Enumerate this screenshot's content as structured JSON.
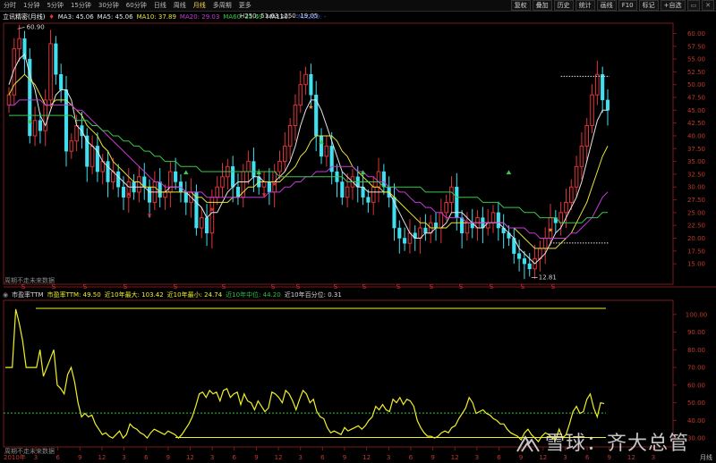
{
  "toolbar": {
    "tabs": [
      "分时",
      "1分钟",
      "5分钟",
      "15分钟",
      "30分钟",
      "60分钟",
      "日线",
      "周线",
      "月线",
      "多周期",
      "更多"
    ],
    "active_tab": "月线",
    "right_buttons": [
      "复权",
      "叠加",
      "历史",
      "统计",
      "画线",
      "F10",
      "标记",
      "+自选"
    ]
  },
  "legend_main": {
    "name": "立讯精密(月线)",
    "ma3": "MA3: 45.06",
    "ma5": "MA5: 45.06",
    "ma10": "MA10: 37.89",
    "ma20": "MA20: 29.03",
    "ma60": "MA60: 25.69",
    "ma120": "MA120: -",
    "ma250": "MA250: -"
  },
  "legend_main_extra": {
    "h250": "H250: 51.63",
    "l250": "L250: 19.05"
  },
  "legend_pe": {
    "name": "市盈率TTM",
    "pe": "市盈率TTM: 49.50",
    "max10": "近10年最大: 103.42",
    "min10": "近10年最小: 24.74",
    "median10": "近10年中位: 44.20",
    "pct10": "近10年百分位: 0.31"
  },
  "annotations": {
    "high_label": "60.90",
    "low_label": "12.81",
    "no_future_1": "周期不走未来数据",
    "no_future_2": "周期不走未来数据",
    "year_label": "2010年",
    "period_label": "月线"
  },
  "watermark": {
    "text": "雪球：齐大总管"
  },
  "colors": {
    "up": "#e0343a",
    "down": "#40e0f0",
    "ma_white": "#e6e6e6",
    "ma_yellow": "#e8e23a",
    "ma_magenta": "#c63ad8",
    "ma_green": "#3ac84a",
    "pe_line": "#f0f02a",
    "median": "#27c23f"
  },
  "chart_data": [
    {
      "type": "candlestick",
      "title": "立讯精密(月线)",
      "y_ticks": [
        15,
        17.5,
        20,
        22.5,
        25,
        27.5,
        30,
        32.5,
        35,
        37.5,
        40,
        42.5,
        45,
        47.5,
        50,
        52.5,
        55,
        57.5,
        60
      ],
      "y_tick_labels": [
        "15.00",
        "17.50",
        "20.00",
        "22.50",
        "25.00",
        "27.50",
        "30.00",
        "32.50",
        "35.00",
        "37.50",
        "40.00",
        "42.50",
        "45.00",
        "47.50",
        "50.00",
        "52.50",
        "55.00",
        "57.50",
        "60.00"
      ],
      "ylim": [
        11,
        62
      ],
      "x_tick_labels": [
        "3",
        "6",
        "9",
        "12",
        "3",
        "6",
        "9",
        "12",
        "3",
        "6",
        "9",
        "12",
        "3",
        "6",
        "9",
        "12",
        "3",
        "6",
        "9",
        "12",
        "3",
        "6",
        "9",
        "12",
        "3",
        "6",
        "9",
        "12",
        "3"
      ],
      "closes": [
        48,
        57,
        59,
        55,
        40,
        43,
        41,
        47,
        58,
        52,
        49,
        37,
        39,
        42,
        40,
        34,
        38,
        33,
        35,
        31,
        33,
        30,
        28,
        31,
        29,
        32,
        30,
        27,
        31,
        28,
        29,
        33,
        31,
        29,
        27,
        29,
        22,
        24,
        21,
        28,
        30,
        32,
        34,
        30,
        28,
        33,
        35,
        32,
        30,
        31,
        29,
        33,
        35,
        38,
        42,
        46,
        50,
        52,
        48,
        40,
        36,
        38,
        33,
        31,
        28,
        30,
        32,
        30,
        28,
        27,
        30,
        33,
        30,
        28,
        22,
        20,
        19,
        21,
        20,
        22,
        21,
        23,
        22,
        25,
        27,
        30,
        24,
        21,
        23,
        22,
        24,
        22,
        23,
        25,
        22,
        21,
        20,
        17,
        16,
        15,
        14,
        16,
        18,
        20,
        24,
        23,
        25,
        27,
        30,
        34,
        38,
        42,
        48,
        52,
        47,
        45
      ],
      "ma_series": [
        {
          "name": "MA5",
          "values": [
            50,
            53,
            55,
            56,
            52,
            49,
            44,
            42,
            45,
            48,
            49,
            49,
            47,
            42,
            41,
            39,
            38,
            37,
            35,
            34,
            33,
            32,
            31,
            30,
            30,
            30,
            30,
            29,
            29,
            29,
            29,
            30,
            30,
            30,
            29,
            28,
            27,
            26,
            24,
            25,
            25,
            27,
            29,
            30,
            31,
            31,
            31,
            32,
            32,
            31,
            31,
            31,
            32,
            33,
            35,
            38,
            42,
            45,
            47,
            47,
            45,
            42,
            39,
            36,
            33,
            32,
            31,
            30,
            30,
            29,
            29,
            29,
            29,
            29,
            27,
            25,
            23,
            21,
            20,
            20,
            21,
            21,
            22,
            22,
            23,
            25,
            25,
            25,
            24,
            23,
            22,
            22,
            23,
            23,
            23,
            22,
            21,
            20,
            18,
            17,
            16,
            15,
            16,
            17,
            19,
            21,
            22,
            24,
            26,
            28,
            31,
            35,
            39,
            43,
            45,
            45
          ]
        },
        {
          "name": "MA10",
          "values": [
            48,
            50,
            51,
            52,
            51,
            50,
            48,
            46,
            46,
            47,
            47,
            47,
            46,
            45,
            44,
            42,
            41,
            40,
            38,
            37,
            35,
            34,
            33,
            32,
            31,
            31,
            30,
            30,
            30,
            29,
            29,
            29,
            29,
            29,
            29,
            29,
            28,
            28,
            27,
            27,
            27,
            27,
            27,
            28,
            28,
            29,
            30,
            30,
            31,
            31,
            31,
            31,
            31,
            32,
            33,
            34,
            36,
            37,
            39,
            40,
            40,
            40,
            40,
            39,
            37,
            36,
            34,
            33,
            32,
            31,
            30,
            30,
            29,
            29,
            28,
            27,
            26,
            25,
            24,
            23,
            23,
            22,
            22,
            22,
            22,
            23,
            23,
            23,
            23,
            23,
            23,
            23,
            23,
            23,
            23,
            23,
            22,
            22,
            21,
            20,
            19,
            18,
            18,
            18,
            18,
            18,
            19,
            20,
            21,
            23,
            25,
            27,
            30,
            33,
            36,
            38
          ]
        },
        {
          "name": "MA20",
          "values": [
            46,
            46,
            47,
            47,
            47,
            47,
            47,
            46,
            46,
            46,
            46,
            46,
            46,
            45,
            45,
            44,
            43,
            42,
            41,
            40,
            39,
            38,
            37,
            36,
            35,
            34,
            33,
            32,
            31,
            31,
            30,
            30,
            30,
            30,
            29,
            29,
            29,
            29,
            28,
            28,
            28,
            28,
            28,
            28,
            28,
            28,
            28,
            28,
            28,
            28,
            29,
            29,
            29,
            30,
            30,
            31,
            31,
            32,
            32,
            33,
            33,
            33,
            34,
            34,
            34,
            34,
            34,
            33,
            33,
            32,
            32,
            31,
            31,
            30,
            30,
            29,
            29,
            28,
            27,
            27,
            26,
            26,
            25,
            25,
            24,
            24,
            24,
            24,
            23,
            23,
            23,
            23,
            23,
            23,
            23,
            23,
            22,
            22,
            22,
            22,
            21,
            21,
            20,
            20,
            20,
            20,
            20,
            20,
            21,
            21,
            22,
            23,
            24,
            26,
            28,
            29
          ]
        },
        {
          "name": "MA60",
          "values": [
            44,
            44,
            44,
            44,
            44,
            44,
            44,
            44,
            44,
            44,
            44,
            44,
            44,
            43,
            43,
            43,
            42,
            42,
            41,
            41,
            40,
            40,
            39,
            39,
            38,
            38,
            37,
            37,
            36,
            36,
            35,
            35,
            35,
            34,
            34,
            34,
            34,
            33,
            33,
            33,
            33,
            33,
            33,
            33,
            33,
            33,
            33,
            33,
            33,
            33,
            33,
            33,
            32,
            32,
            32,
            32,
            32,
            32,
            32,
            32,
            32,
            32,
            32,
            32,
            32,
            31,
            31,
            31,
            31,
            31,
            31,
            31,
            30,
            30,
            30,
            30,
            30,
            30,
            30,
            30,
            29,
            29,
            29,
            29,
            29,
            29,
            28,
            28,
            28,
            28,
            28,
            27,
            27,
            27,
            27,
            26,
            26,
            26,
            26,
            25,
            25,
            25,
            24,
            24,
            24,
            24,
            23,
            23,
            23,
            23,
            23,
            24,
            24,
            24,
            25,
            25
          ]
        }
      ]
    },
    {
      "type": "line",
      "title": "市盈率TTM",
      "y_ticks": [
        30,
        40,
        50,
        60,
        70,
        80,
        90,
        100
      ],
      "y_tick_labels": [
        "30.00",
        "40.00",
        "50.00",
        "60.00",
        "70.00",
        "80.00",
        "90.00",
        "100.00"
      ],
      "ylim": [
        25,
        108
      ],
      "series": [
        {
          "name": "市盈率TTM",
          "values": [
            70,
            70,
            70,
            103,
            95,
            85,
            70,
            70,
            70,
            70,
            80,
            65,
            70,
            75,
            80,
            60,
            58,
            55,
            66,
            70,
            62,
            50,
            42,
            44,
            42,
            43,
            38,
            35,
            32,
            33,
            31,
            30,
            32,
            34,
            30,
            32,
            38,
            36,
            35,
            33,
            32,
            30,
            33,
            35,
            34,
            33,
            32,
            34,
            33,
            32,
            30,
            32,
            35,
            38,
            42,
            48,
            55,
            56,
            53,
            57,
            55,
            56,
            51,
            57,
            58,
            53,
            55,
            56,
            49,
            55,
            51,
            50,
            46,
            51,
            48,
            45,
            47,
            56,
            55,
            53,
            50,
            57,
            55,
            51,
            46,
            52,
            57,
            55,
            50,
            52,
            45,
            42,
            41,
            36,
            33,
            34,
            33,
            32,
            36,
            34,
            35,
            36,
            37,
            35,
            37,
            40,
            42,
            48,
            46,
            49,
            46,
            45,
            52,
            50,
            53,
            49,
            52,
            51,
            48,
            40,
            36,
            33,
            31,
            31,
            30,
            31,
            33,
            34,
            33,
            36,
            37,
            41,
            44,
            47,
            53,
            50,
            44,
            45,
            46,
            44,
            43,
            41,
            40,
            38,
            38,
            35,
            33,
            32,
            31,
            29,
            33,
            35,
            32,
            30,
            28,
            31,
            33,
            32,
            30,
            29,
            35,
            30,
            32,
            38,
            45,
            48,
            44,
            45,
            52,
            55,
            47,
            42,
            50,
            49.5
          ]
        },
        {
          "name": "近10年最大",
          "values": [
            103.42
          ]
        },
        {
          "name": "近10年中位",
          "values": [
            44.2
          ]
        },
        {
          "name": "近10年最小",
          "values": [
            24.74
          ]
        }
      ]
    }
  ]
}
